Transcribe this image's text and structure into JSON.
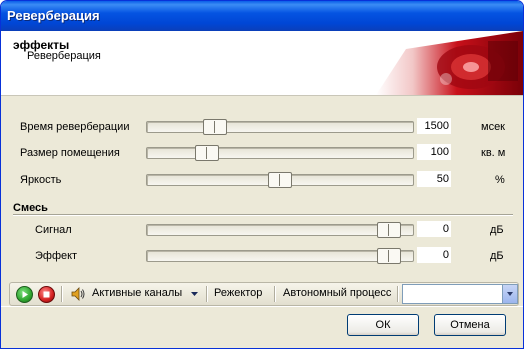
{
  "window": {
    "title": "Реверберация"
  },
  "header": {
    "title": "эффекты",
    "subtitle": "Реверберация"
  },
  "sliders": [
    {
      "label": "Время реверберации",
      "value": "1500",
      "unit": "мсек",
      "level": 0.23
    },
    {
      "label": "Размер помещения",
      "value": "100",
      "unit": "кв. м",
      "level": 0.2
    },
    {
      "label": "Яркость",
      "value": "50",
      "unit": "%",
      "level": 0.5
    }
  ],
  "mix": {
    "title": "Смесь",
    "sliders": [
      {
        "label": "Сигнал",
        "value": "0",
        "unit": "дБ",
        "level": 0.95
      },
      {
        "label": "Эффект",
        "value": "0",
        "unit": "дБ",
        "level": 0.95
      }
    ]
  },
  "toolbar": {
    "play_icon": "play-icon",
    "stop_icon": "stop-icon",
    "speaker_icon": "speaker-icon",
    "channels_label": "Активные каналы",
    "rejector_label": "Режектор",
    "autonomous_label": "Автономный процесс",
    "select_value": ""
  },
  "buttons": {
    "ok": "ОК",
    "cancel": "Отмена"
  },
  "colors": {
    "titlebar": "#0554e2",
    "play": "#2fa52f",
    "stop": "#d42020",
    "header_art": "#c8101a"
  }
}
